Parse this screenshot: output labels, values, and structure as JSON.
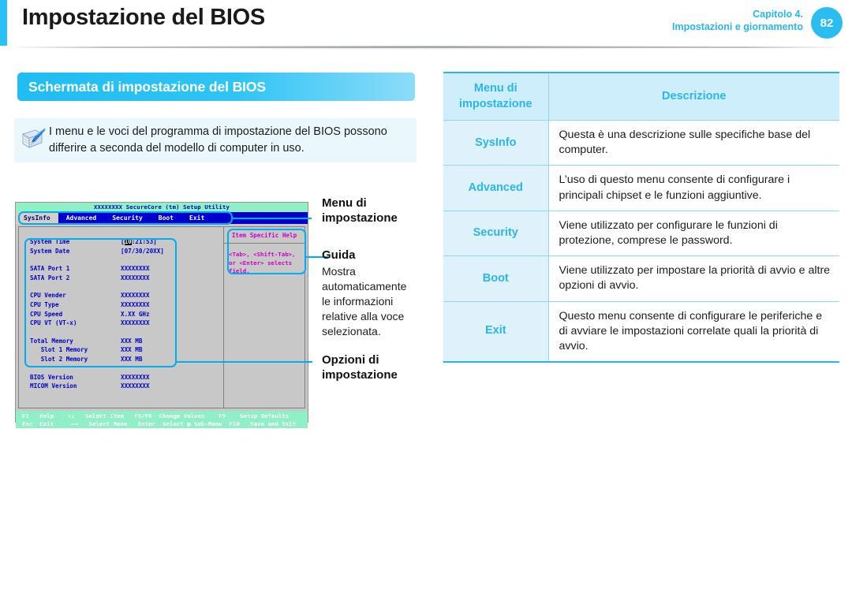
{
  "header": {
    "title": "Impostazione del BIOS",
    "chapter": "Capitolo 4.",
    "subtitle": "Impostazioni e giornamento",
    "page_number": "82",
    "accent_color": "#29c0f5"
  },
  "section": {
    "heading": "Schermata di impostazione del BIOS"
  },
  "note": {
    "icon": "note-pen-icon",
    "text": "I menu e le voci del programma di impostazione del BIOS possono differire a seconda del modello di computer in uso."
  },
  "bios": {
    "window_title": "XXXXXXXX SecureCore (tm) Setup Utility",
    "tabs": [
      {
        "label": "SysInfo",
        "selected": true
      },
      {
        "label": "Advanced",
        "selected": false
      },
      {
        "label": "Security",
        "selected": false
      },
      {
        "label": "Boot",
        "selected": false
      },
      {
        "label": "Exit",
        "selected": false
      }
    ],
    "rows": [
      {
        "key": "System Time",
        "value_prefix": "[",
        "value_hl": "10",
        "value_suffix": ":21:53]"
      },
      {
        "key": "System Date",
        "value": "[07/30/20XX]"
      },
      {
        "key": "",
        "value": ""
      },
      {
        "key": "SATA Port 1",
        "value": "XXXXXXXX"
      },
      {
        "key": "SATA Port 2",
        "value": "XXXXXXXX"
      },
      {
        "key": "",
        "value": ""
      },
      {
        "key": "CPU Vender",
        "value": "XXXXXXXX"
      },
      {
        "key": "CPU Type",
        "value": "XXXXXXXX"
      },
      {
        "key": "CPU Speed",
        "value": "X.XX GHz"
      },
      {
        "key": "CPU VT (VT-x)",
        "value": "XXXXXXXX"
      },
      {
        "key": "",
        "value": ""
      },
      {
        "key": "Total Memory",
        "value": "XXX MB"
      },
      {
        "key": "   Slot 1 Memory",
        "value": "XXX MB"
      },
      {
        "key": "   Slot 2 Memory",
        "value": "XXX MB"
      },
      {
        "key": "",
        "value": ""
      },
      {
        "key": "BIOS Version",
        "value": "XXXXXXXX"
      },
      {
        "key": "MICOM Version",
        "value": "XXXXXXXX"
      }
    ],
    "help": {
      "title": "Item Specific Help",
      "line1": "<Tab>, <Shift-Tab>,",
      "line2": "or <Enter> selects",
      "line3": "field."
    },
    "footer": {
      "line1": "F1   Help    ↑↓   Select Item   F5/F6  Change Values    F9    Setup Defaults",
      "line2": "Esc  Exit     ←→   Select Menu   Enter  Select ▣ Sub-Menu  F10   Save and Exit"
    }
  },
  "callouts": {
    "menu_label_line1": "Menu di",
    "menu_label_line2": "impostazione",
    "guide_label": "Guida",
    "guide_body": "Mostra automaticamente le informazioni relative alla voce selezionata.",
    "options_label_line1": "Opzioni di",
    "options_label_line2": "impostazione"
  },
  "table": {
    "headers": {
      "menu_line1": "Menu di",
      "menu_line2": "impostazione",
      "description": "Descrizione"
    },
    "rows": [
      {
        "menu": "SysInfo",
        "description": "Questa è una descrizione sulle specifiche base del computer."
      },
      {
        "menu": "Advanced",
        "description": "L’uso di questo menu consente di configurare i principali chipset e le funzioni aggiuntive."
      },
      {
        "menu": "Security",
        "description": "Viene utilizzato per configurare le funzioni di protezione, comprese le password."
      },
      {
        "menu": "Boot",
        "description": "Viene utilizzato per impostare la priorità di avvio e altre opzioni di avvio."
      },
      {
        "menu": "Exit",
        "description": "Questo menu consente di configurare le periferiche e di avviare le impostazioni correlate quali la priorità di avvio."
      }
    ]
  }
}
